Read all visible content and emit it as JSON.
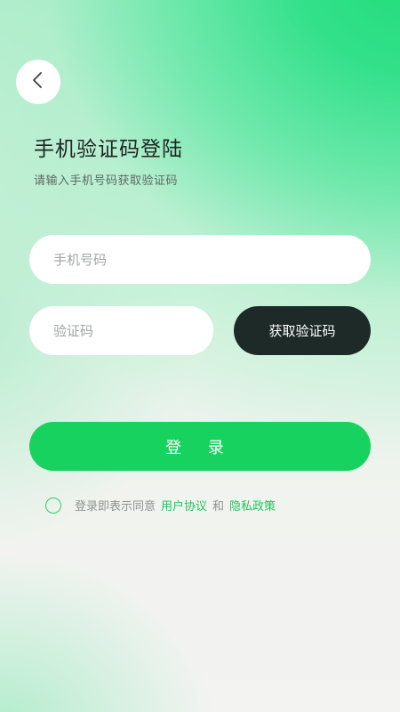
{
  "header": {
    "back_icon": "chevron-left-icon",
    "title": "手机验证码登陆",
    "subtitle": "请输入手机号码获取验证码"
  },
  "form": {
    "phone_placeholder": "手机号码",
    "code_placeholder": "验证码",
    "get_code_label": "获取验证码",
    "login_label": "登 录"
  },
  "agreement": {
    "prefix": "登录即表示同意",
    "user_agreement": "用户协议",
    "conjunction": "和",
    "privacy_policy": "隐私政策",
    "checked": false
  },
  "colors": {
    "accent": "#17d25e",
    "dark_button": "#1d2a27",
    "link": "#22c35f"
  }
}
